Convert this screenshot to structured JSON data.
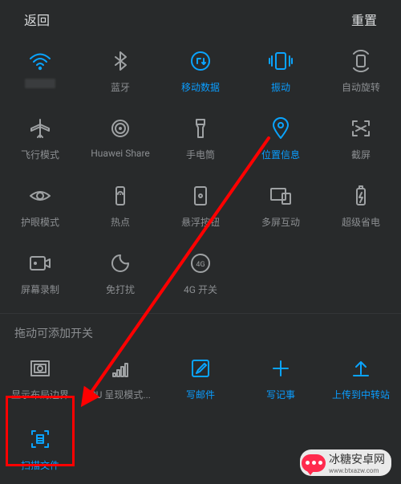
{
  "colors": {
    "accent": "#0aa4ff",
    "bg": "#282a2b",
    "muted": "#8b8e91",
    "highlight": "#ff0000"
  },
  "topbar": {
    "back": "返回",
    "reset": "重置"
  },
  "tiles": [
    {
      "name": "wifi",
      "label": "",
      "icon": "wifi",
      "active": true,
      "interactable": true
    },
    {
      "name": "bluetooth",
      "label": "蓝牙",
      "icon": "bluetooth",
      "active": false,
      "interactable": true
    },
    {
      "name": "mobile-data",
      "label": "移动数据",
      "icon": "mobile-data",
      "active": true,
      "interactable": true
    },
    {
      "name": "vibrate",
      "label": "振动",
      "icon": "vibrate",
      "active": true,
      "interactable": true
    },
    {
      "name": "auto-rotate",
      "label": "自动旋转",
      "icon": "rotate",
      "active": false,
      "interactable": true
    },
    {
      "name": "airplane-mode",
      "label": "飞行模式",
      "icon": "plane",
      "active": false,
      "interactable": true
    },
    {
      "name": "huawei-share",
      "label": "Huawei Share",
      "icon": "huawei-share",
      "active": false,
      "interactable": true
    },
    {
      "name": "flashlight",
      "label": "手电筒",
      "icon": "flashlight",
      "active": false,
      "interactable": true
    },
    {
      "name": "location",
      "label": "位置信息",
      "icon": "location",
      "active": true,
      "interactable": true
    },
    {
      "name": "screenshot",
      "label": "截屏",
      "icon": "screenshot",
      "active": false,
      "interactable": true
    },
    {
      "name": "eye-comfort",
      "label": "护眼模式",
      "icon": "eye",
      "active": false,
      "interactable": true
    },
    {
      "name": "hotspot",
      "label": "热点",
      "icon": "hotspot",
      "active": false,
      "interactable": true
    },
    {
      "name": "floating-button",
      "label": "悬浮按钮",
      "icon": "float",
      "active": false,
      "interactable": true
    },
    {
      "name": "multiscreen",
      "label": "多屏互动",
      "icon": "multiscreen",
      "active": false,
      "interactable": true
    },
    {
      "name": "ultra-power-saving",
      "label": "超级省电",
      "icon": "battery",
      "active": false,
      "interactable": true
    },
    {
      "name": "screen-record",
      "label": "屏幕录制",
      "icon": "record",
      "active": false,
      "interactable": true
    },
    {
      "name": "do-not-disturb",
      "label": "免打扰",
      "icon": "dnd",
      "active": false,
      "interactable": true
    },
    {
      "name": "4g-switch",
      "label": "4G 开关",
      "icon": "4g",
      "active": false,
      "interactable": true
    },
    {
      "name": "blank1",
      "label": "",
      "icon": "",
      "active": false,
      "interactable": false
    },
    {
      "name": "blank2",
      "label": "",
      "icon": "",
      "active": false,
      "interactable": false
    }
  ],
  "hint": "拖动可添加开关",
  "extra": [
    {
      "name": "show-layout-bounds",
      "label": "显示布局边界",
      "icon": "layout",
      "active": false
    },
    {
      "name": "gpu-render-mode",
      "label": "PU 呈现模式...",
      "icon": "gpu",
      "active": false
    },
    {
      "name": "write-mail",
      "label": "写邮件",
      "icon": "mail",
      "active": true
    },
    {
      "name": "write-note",
      "label": "写记事",
      "icon": "plus",
      "active": true
    },
    {
      "name": "upload-transfer",
      "label": "上传到中转站",
      "icon": "upload",
      "active": true
    }
  ],
  "extra2": [
    {
      "name": "scan-document",
      "label": "扫描文件",
      "icon": "scan",
      "active": true
    }
  ],
  "watermark": "冰糖安卓网",
  "watermark_sub": "www.btxazw.com"
}
